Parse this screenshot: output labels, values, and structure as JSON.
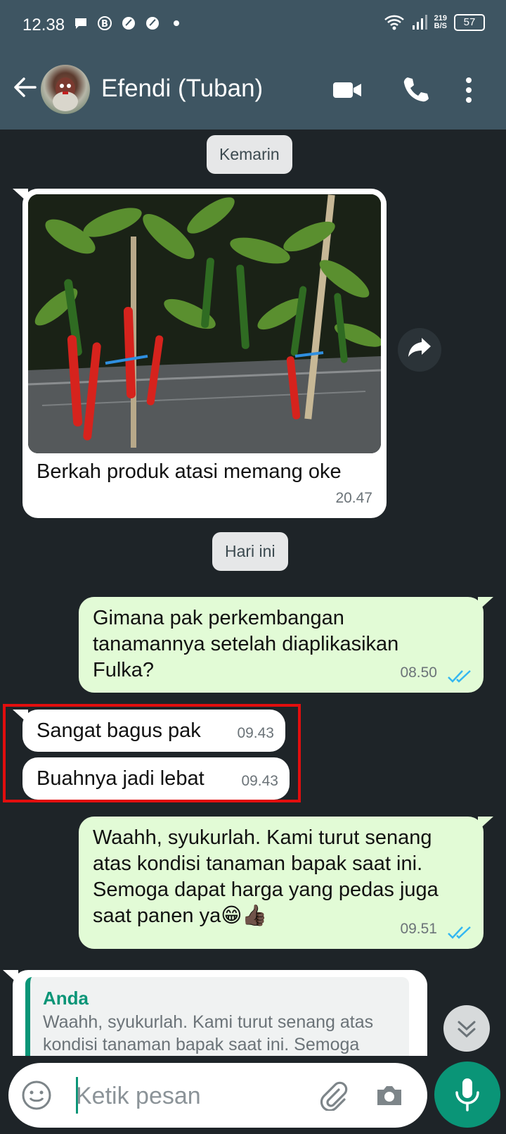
{
  "status_bar": {
    "time": "12.38",
    "speed_value": "219",
    "speed_unit": "B/S",
    "battery": "57"
  },
  "header": {
    "contact_name": "Efendi (Tuban)"
  },
  "chat": {
    "date_yesterday": "Kemarin",
    "date_today": "Hari ini",
    "messages": [
      {
        "text": "Berkah produk atasi memang oke",
        "time": "20.47"
      },
      {
        "text": "Gimana pak perkembangan tanamannya setelah diaplikasikan Fulka?",
        "time": "08.50"
      },
      {
        "text": "Sangat bagus pak",
        "time": "09.43"
      },
      {
        "text": "Buahnya jadi lebat",
        "time": "09.43"
      },
      {
        "text": "Waahh, syukurlah. Kami turut senang atas kondisi tanaman bapak saat ini. Semoga dapat harga yang pedas juga saat panen ya😁👍🏿",
        "time": "09.51"
      }
    ],
    "reply": {
      "quoted_name": "Anda",
      "quoted_text": "Waahh, syukurlah. Kami turut senang atas kondisi tanaman bapak saat ini. Semoga"
    }
  },
  "composer": {
    "placeholder": "Ketik pesan"
  },
  "colors": {
    "header_bg": "#3e5562",
    "chat_bg": "#1e2428",
    "incoming_bubble": "#ffffff",
    "outgoing_bubble": "#e2fbd6",
    "accent": "#0a9577",
    "read_ticks": "#34b7f1",
    "highlight_border": "#e20e0e"
  },
  "icons": [
    "back-arrow-icon",
    "video-call-icon",
    "phone-icon",
    "more-vert-icon",
    "share-forward-icon",
    "double-check-icon",
    "scroll-down-icon",
    "emoji-icon",
    "attach-icon",
    "camera-icon",
    "mic-icon"
  ]
}
